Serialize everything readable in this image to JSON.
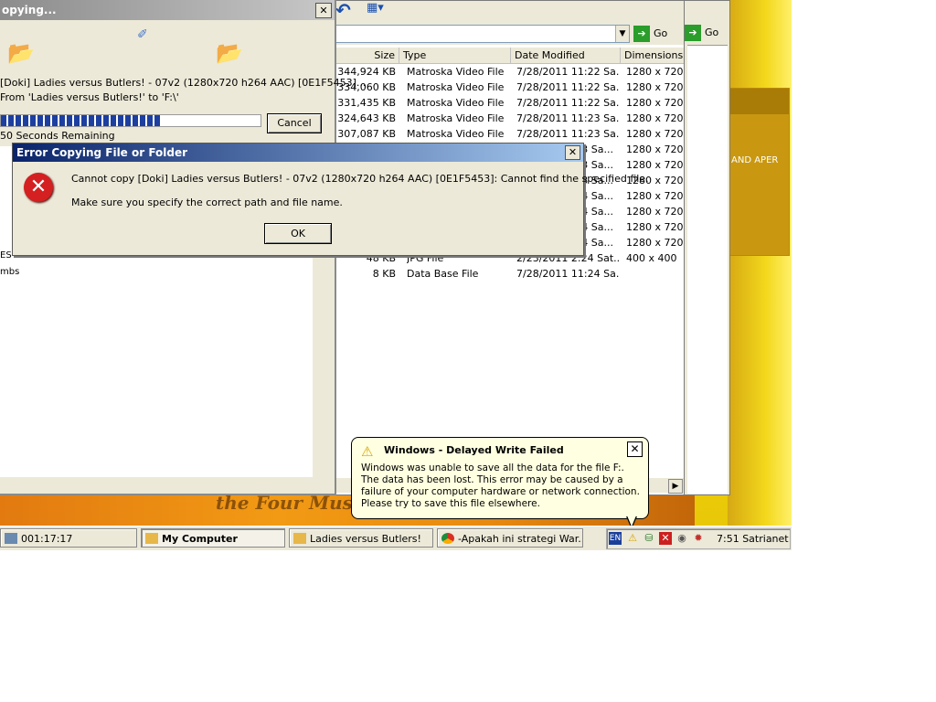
{
  "explorer": {
    "go_label": "Go",
    "go2_label": "Go",
    "columns": [
      "Size",
      "Type",
      "Date Modified",
      "Dimensions"
    ],
    "files": [
      {
        "size": "344,924 KB",
        "type": "Matroska Video File",
        "date": "7/28/2011 11:22 Sa...",
        "dim": "1280 x 720"
      },
      {
        "size": "334,060 KB",
        "type": "Matroska Video File",
        "date": "7/28/2011 11:22 Sa...",
        "dim": "1280 x 720"
      },
      {
        "size": "331,435 KB",
        "type": "Matroska Video File",
        "date": "7/28/2011 11:22 Sa...",
        "dim": "1280 x 720"
      },
      {
        "size": "324,643 KB",
        "type": "Matroska Video File",
        "date": "7/28/2011 11:23 Sa...",
        "dim": "1280 x 720"
      },
      {
        "size": "307,087 KB",
        "type": "Matroska Video File",
        "date": "7/28/2011 11:23 Sa...",
        "dim": "1280 x 720"
      },
      {
        "size": "",
        "type": "",
        "date": "3 Sa...",
        "dim": "1280 x 720"
      },
      {
        "size": "",
        "type": "",
        "date": "3 Sa...",
        "dim": "1280 x 720"
      },
      {
        "size": "",
        "type": "",
        "date": "3 Sa...",
        "dim": "1280 x 720"
      },
      {
        "size": "",
        "type": "",
        "date": "4 Sa...",
        "dim": "1280 x 720"
      },
      {
        "size": "",
        "type": "",
        "date": "4 Sa...",
        "dim": "1280 x 720"
      },
      {
        "size": "",
        "type": "",
        "date": "4 Sa...",
        "dim": "1280 x 720"
      },
      {
        "size": "",
        "type": "",
        "date": "4 Sa...",
        "dim": "1280 x 720"
      },
      {
        "size": "48 KB",
        "type": "JPG File",
        "date": "2/23/2011 2:24 Sat...",
        "dim": "400 x 400"
      },
      {
        "size": "8 KB",
        "type": "Data Base File",
        "date": "7/28/2011 11:24 Sa...",
        "dim": ""
      }
    ]
  },
  "copying": {
    "title": "opying...",
    "file_line": "[Doki] Ladies versus Butlers! - 07v2 (1280x720 h264 AAC) [0E1F5453]...",
    "from_line": "From 'Ladies versus Butlers!' to 'F:\\'",
    "cancel_label": "Cancel",
    "remaining": "50 Seconds Remaining",
    "progress": 0.62,
    "left_items": [
      "ES VS BUTLERS",
      "mbs"
    ]
  },
  "error_dialog": {
    "title": "Error Copying File or Folder",
    "message": "Cannot copy [Doki] Ladies versus Butlers! - 07v2 (1280x720 h264 AAC) [0E1F5453]: Cannot find the specified file.",
    "hint": "Make sure you specify the correct path and file  name.",
    "ok_label": "OK"
  },
  "balloon": {
    "title": "Windows - Delayed Write Failed",
    "text": "Windows was unable to save all the data for the file F:. The data has been lost. This error may be caused by a failure of your computer hardware or network connection. Please try to save this file elsewhere."
  },
  "desktop": {
    "wall_text": "AND APER",
    "tagline": "the Four Mus"
  },
  "taskbar": {
    "items": [
      {
        "label": "001:17:17"
      },
      {
        "label": "My Computer"
      },
      {
        "label": "Ladies versus Butlers!"
      },
      {
        "label": "-Apakah ini strategi War..."
      }
    ],
    "lang": "EN",
    "clock": "7:51 Satrianet"
  }
}
